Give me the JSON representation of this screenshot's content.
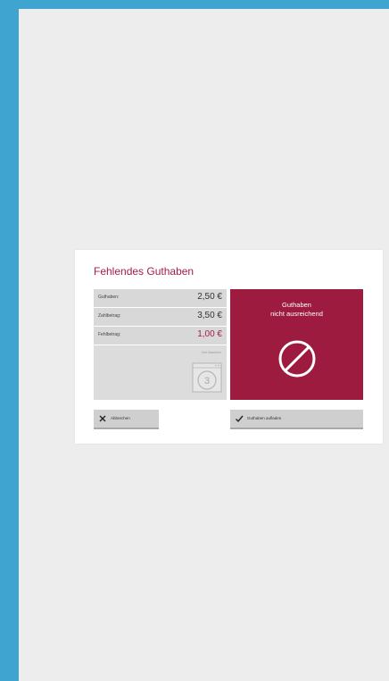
{
  "dialog": {
    "title": "Fehlendes Guthaben",
    "rows": [
      {
        "label": "Guthaben:",
        "value": "2,50 €"
      },
      {
        "label": "Zahlbetrag:",
        "value": "3,50 €"
      },
      {
        "label": "Fehlbetrag:",
        "value": "1,00 €"
      }
    ],
    "machine": {
      "caption": "Ihre Maschine",
      "number": "3"
    },
    "message": {
      "line1": "Guthaben",
      "line2": "nicht ausreichend"
    },
    "buttons": {
      "cancel": "Abbrechen",
      "topup": "Guthaben aufladen"
    }
  },
  "colors": {
    "accent": "#9c1b3f",
    "title": "#a51e45",
    "frame": "#3fa4d0",
    "background": "#ecedec"
  },
  "icons": {
    "message": "forbidden-icon",
    "machine": "washing-machine-icon",
    "cancel": "close-icon",
    "topup": "checkmark-icon"
  }
}
